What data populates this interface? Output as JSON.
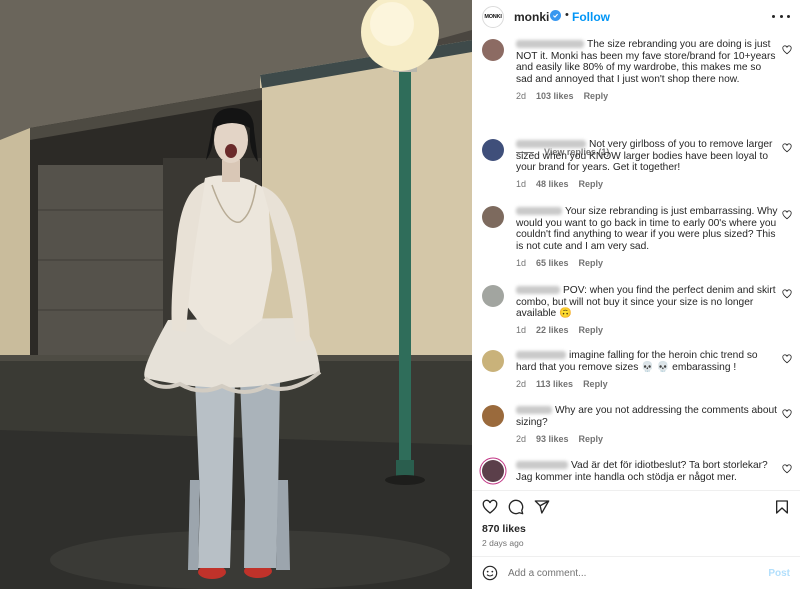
{
  "post": {
    "username": "monki",
    "avatar_text": "MONKI",
    "verified_icon": "verified-badge-icon",
    "follow_label": "Follow",
    "more_icon": "more-options-icon"
  },
  "comments": [
    {
      "text": "The size rebranding you are doing is just NOT it. Monki has been my fave store/brand for 10+years and easily like 80% of my wardrobe, this makes me so sad and annoyed that I just won't shop there now.",
      "age": "2d",
      "likes": "103 likes",
      "reply": "Reply",
      "avatar_color": "#8c6b63"
    },
    {
      "text": "Not very girlboss of you to remove larger sized when you KNOW larger bodies have been loyal to your brand for years. Get it together!",
      "age": "1d",
      "likes": "48 likes",
      "reply": "Reply",
      "avatar_color": "#3f4f7a"
    },
    {
      "text": "Your size rebranding is just embarrassing. Why would you want to go back in time to early 00's where you couldn't find anything to wear if you were plus sized? This is not cute and I am very sad.",
      "age": "1d",
      "likes": "65 likes",
      "reply": "Reply",
      "avatar_color": "#7d6a5e"
    },
    {
      "text": "POV: when you find the perfect denim and skirt combo, but will not buy it since your size is no longer available 🙃",
      "age": "1d",
      "likes": "22 likes",
      "reply": "Reply",
      "avatar_color": "#a2a5a0"
    },
    {
      "text": "imagine falling for the heroin chic trend so hard that you remove sizes 💀 💀  embarassing !",
      "age": "2d",
      "likes": "113 likes",
      "reply": "Reply",
      "avatar_color": "#c9b27a"
    },
    {
      "text": "Why are you not addressing the comments about sizing?",
      "age": "2d",
      "likes": "93 likes",
      "reply": "Reply",
      "avatar_color": "#9a6a3c"
    },
    {
      "text": "Vad är det för idiotbeslut? Ta bort storlekar? Jag kommer inte handla och stödja er något mer.",
      "age": "",
      "likes": "",
      "reply": "",
      "avatar_color": "#5b3f4a"
    }
  ],
  "view_replies": "View replies (1)",
  "actions": {
    "like_icon": "heart-icon",
    "comment_icon": "comment-icon",
    "share_icon": "share-icon",
    "save_icon": "bookmark-icon"
  },
  "likes_count": "870 likes",
  "posted": "2 days ago",
  "add_comment": {
    "emoji_icon": "emoji-icon",
    "placeholder": "Add a comment...",
    "post_label": "Post"
  },
  "colors": {
    "accent": "#0095f6",
    "muted": "#737373",
    "post_disabled": "#b2dffc"
  }
}
